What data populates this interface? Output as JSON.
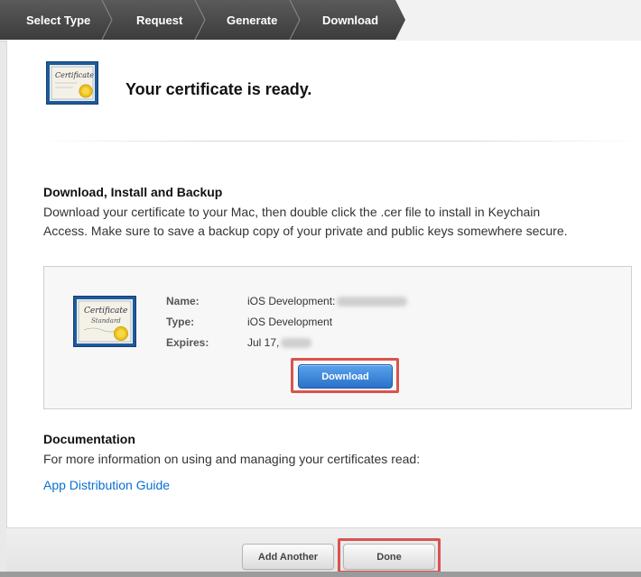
{
  "steps": [
    {
      "label": "Select Type"
    },
    {
      "label": "Request"
    },
    {
      "label": "Generate"
    },
    {
      "label": "Download"
    }
  ],
  "colors": {
    "step_dark": "#4a4a4a",
    "step_active": "#3e3e3e",
    "highlight": "#d9534f",
    "primary_button": "#2a71c9",
    "link": "#0a6fd1"
  },
  "header": {
    "icon": "certificate-icon",
    "title": "Your certificate is ready."
  },
  "backup_section": {
    "title": "Download, Install and Backup",
    "line1": "Download your certificate to your Mac, then double click the .cer file to install in Keychain",
    "line2": "Access. Make sure to save a backup copy of your private and public keys somewhere secure."
  },
  "certificate": {
    "icon": "certificate-icon",
    "name_label": "Name:",
    "name_value": "iOS Development:",
    "type_label": "Type:",
    "type_value": "iOS Development",
    "expires_label": "Expires:",
    "expires_value": "Jul 17,",
    "download_label": "Download"
  },
  "documentation": {
    "title": "Documentation",
    "text": "For more information on using and managing your certificates read:",
    "link": "App Distribution Guide"
  },
  "footer": {
    "add_another": "Add Another",
    "done": "Done"
  }
}
